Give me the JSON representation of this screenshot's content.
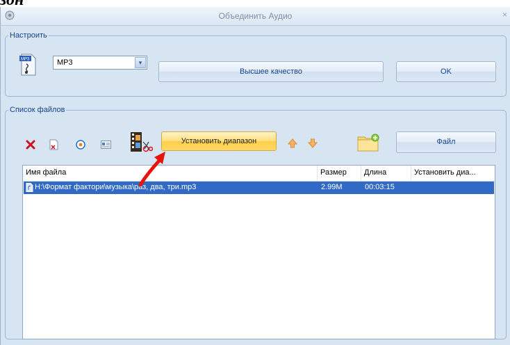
{
  "document": {
    "heading_fragment": "зон"
  },
  "window": {
    "title": "Объединить Аудио",
    "close_glyph": "×"
  },
  "settings_group": {
    "legend": "Настроить",
    "format_icon": "mp3-file-icon",
    "format_select": {
      "selected": "MP3",
      "arrow_glyph": "▾"
    },
    "quality_button": "Высшее качество",
    "ok_button": "OK"
  },
  "files_group": {
    "legend": "Список файлов",
    "toolbar": {
      "icons": [
        "delete-icon",
        "clear-list-icon",
        "play-icon",
        "info-icon",
        "video-clip-icon",
        "move-up-icon",
        "move-down-icon",
        "add-folder-icon"
      ],
      "range_button": "Установить диапазон",
      "file_button": "Файл"
    },
    "table": {
      "columns": [
        "Имя файла",
        "Размер",
        "Длина",
        "Установить диа..."
      ],
      "rows": [
        {
          "name": "H:\\Формат фактори\\музыка\\раз, два, три.mp3",
          "size": "2.99M",
          "length": "00:03:15",
          "range": "",
          "selected": true
        }
      ]
    }
  },
  "annotation": {
    "arrow_color": "#e8140c"
  },
  "colors": {
    "selection": "#316ac5",
    "accent_orange": "#ffd24d",
    "group_border": "#9db5d1"
  }
}
